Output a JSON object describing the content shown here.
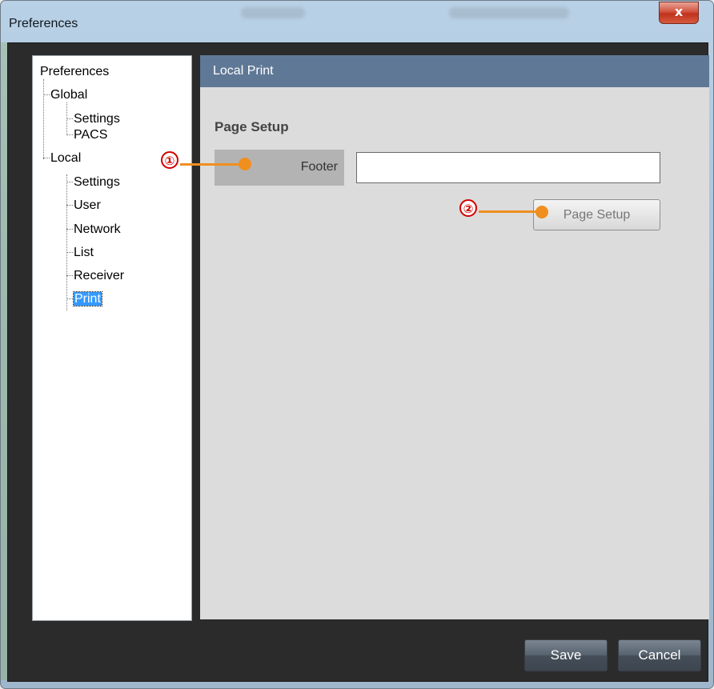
{
  "window": {
    "title": "Preferences",
    "close_glyph": "x"
  },
  "tree": {
    "root": "Preferences",
    "global": {
      "label": "Global",
      "children": [
        "Settings",
        "PACS"
      ]
    },
    "local": {
      "label": "Local",
      "children": [
        "Settings",
        "User",
        "Network",
        "List",
        "Receiver",
        "Print"
      ]
    },
    "selected": "Print"
  },
  "content": {
    "header": "Local Print",
    "section_title": "Page Setup",
    "footer_label": "Footer",
    "footer_value": "",
    "page_setup_button": "Page Setup"
  },
  "buttons": {
    "save": "Save",
    "cancel": "Cancel"
  },
  "callouts": [
    "①",
    "②"
  ],
  "colors": {
    "header_bg": "#5f7896",
    "callout": "#f08f1f",
    "selection": "#3399ff"
  }
}
